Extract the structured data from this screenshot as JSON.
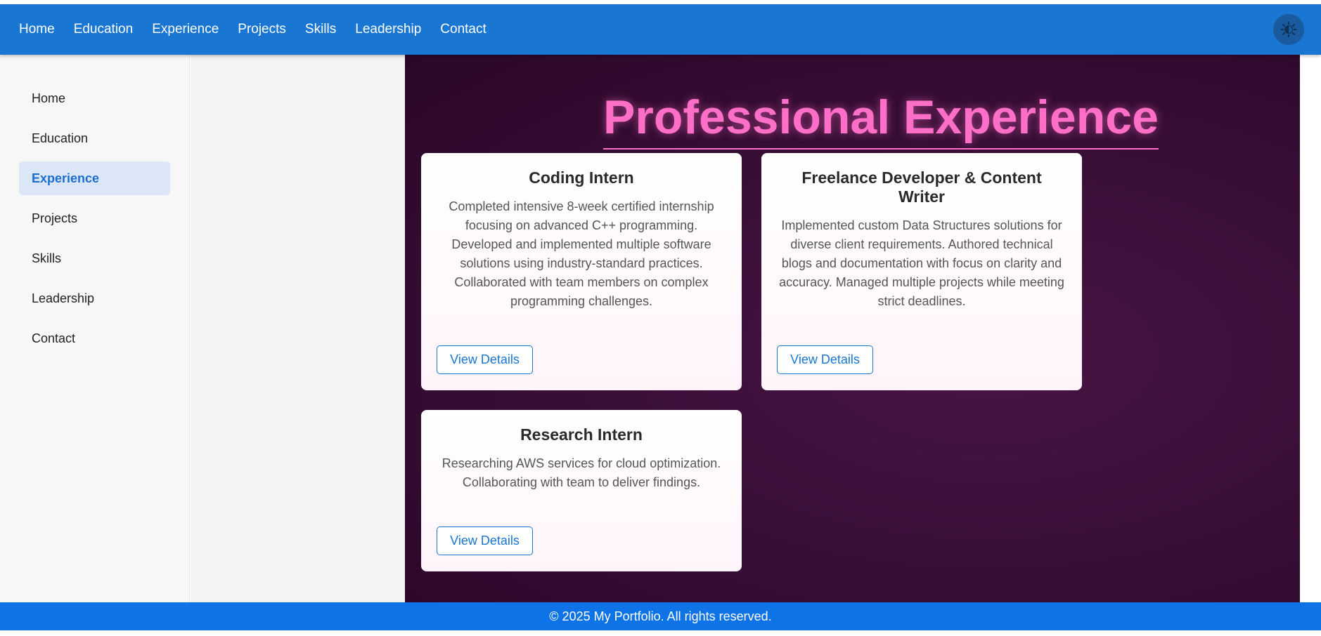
{
  "topnav": {
    "items": [
      "Home",
      "Education",
      "Experience",
      "Projects",
      "Skills",
      "Leadership",
      "Contact"
    ],
    "theme_icon": "theme-toggle-icon"
  },
  "sidebar": {
    "items": [
      {
        "label": "Home"
      },
      {
        "label": "Education"
      },
      {
        "label": "Experience"
      },
      {
        "label": "Projects"
      },
      {
        "label": "Skills"
      },
      {
        "label": "Leadership"
      },
      {
        "label": "Contact"
      }
    ],
    "active": "Experience"
  },
  "experience": {
    "title": "Professional Experience",
    "cards": [
      {
        "title": "Coding Intern",
        "description": "Completed intensive 8-week certified internship focusing on advanced C++ programming. Developed and implemented multiple software solutions using industry-standard practices. Collaborated with team members on complex programming challenges.",
        "button": "View Details"
      },
      {
        "title": "Freelance Developer & Content Writer",
        "description": "Implemented custom Data Structures solutions for diverse client requirements. Authored technical blogs and documentation with focus on clarity and accuracy. Managed multiple projects while meeting strict deadlines.",
        "button": "View Details"
      },
      {
        "title": "Research Intern",
        "description": "Researching AWS services for cloud optimization. Collaborating with team to deliver findings.",
        "button": "View Details"
      }
    ]
  },
  "footer": {
    "text": "© 2025 My Portfolio. All rights reserved."
  },
  "colors": {
    "nav_bg": "#1976d2",
    "accent_pink": "#ff6ec7",
    "section_bg": "#3a0f38",
    "footer_bg": "#0d73e6",
    "active_text": "#1b6fcf"
  }
}
